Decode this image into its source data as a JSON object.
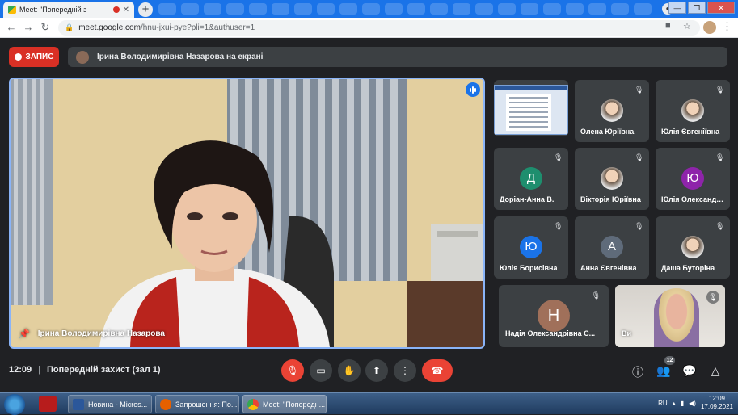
{
  "browser": {
    "tab_title": "Meet: \"Попередній з",
    "url_host": "meet.google.com",
    "url_path": "/hnu-jxui-pye?pli=1&authuser=1",
    "window_controls": [
      "—",
      "❐",
      "✕"
    ]
  },
  "meet": {
    "record_label": "ЗАПИС",
    "presenting_text": "Ірина Володимирівна Назарова на екрані",
    "main_speaker": "Ірина Володимирівна Назарова",
    "meeting_time": "12:09",
    "meeting_name": "Попередній захист (зал 1)",
    "participants_count": "12",
    "accent_color": "#8ab4f8",
    "hangup_color": "#ea4335"
  },
  "participants": [
    {
      "name": "Олена Юріївна",
      "kind": "photo",
      "initial": ""
    },
    {
      "name": "Юлія Євгеніївна",
      "kind": "photo",
      "initial": ""
    },
    {
      "name": "Доріан-Анна В.",
      "kind": "initial",
      "initial": "Д",
      "color": "#1e8e6e"
    },
    {
      "name": "Вікторія Юріївна",
      "kind": "photo",
      "initial": ""
    },
    {
      "name": "Юлія Олександрівна",
      "kind": "initial",
      "initial": "Ю",
      "color": "#8e24aa"
    },
    {
      "name": "Юлія Борисівна",
      "kind": "initial",
      "initial": "Ю",
      "color": "#1a73e8"
    },
    {
      "name": "Анна Євгенівна",
      "kind": "initial",
      "initial": "А",
      "color": "#5f6b7a"
    },
    {
      "name": "Даша Буторіна",
      "kind": "photo",
      "initial": ""
    }
  ],
  "wide_tiles": {
    "nadia_name": "Надія Олександрівна С...",
    "nadia_initial": "Н",
    "self_label": "Ви"
  },
  "taskbar": {
    "apps": [
      "Новина - Micros...",
      "Запрошення: По...",
      "Meet: \"Попередн..."
    ],
    "lang": "RU",
    "time": "12:09",
    "date": "17.09.2021"
  }
}
